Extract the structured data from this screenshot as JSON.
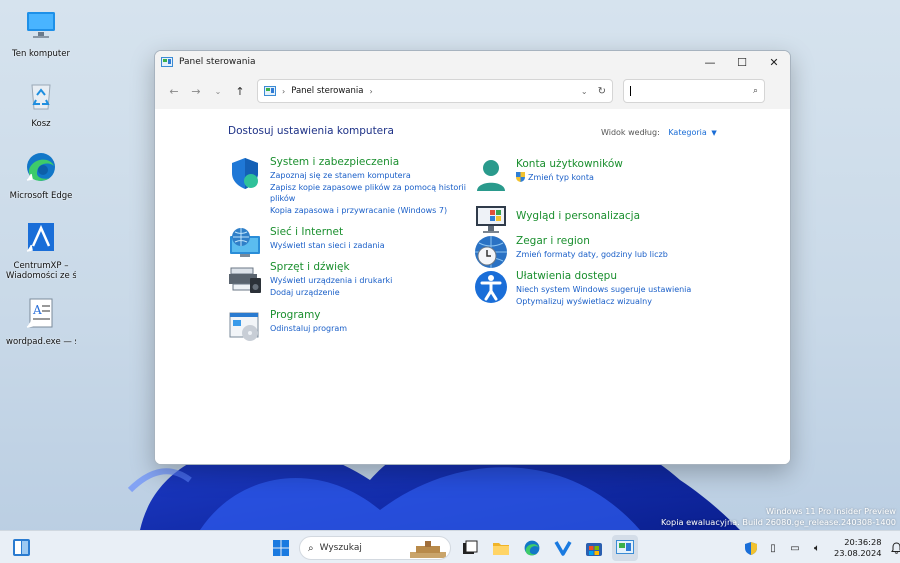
{
  "desktop": {
    "icons": [
      {
        "label": "Ten komputer",
        "icon": "monitor-icon"
      },
      {
        "label": "Kosz",
        "icon": "recycle-bin-icon"
      },
      {
        "label": "Microsoft Edge",
        "icon": "edge-icon"
      },
      {
        "label": "CentrumXP –",
        "label2": "Wiadomości ze ś...",
        "icon": "centrumxp-icon"
      },
      {
        "label": "wordpad.exe — skr...",
        "icon": "wordpad-icon"
      }
    ]
  },
  "window": {
    "title": "Panel sterowania",
    "controls": {
      "minimize": "—",
      "maximize": "☐",
      "close": "✕"
    },
    "breadcrumb": "Panel sterowania",
    "search_placeholder": "",
    "heading": "Dostosuj ustawienia komputera",
    "view_by_label": "Widok według:",
    "view_by_value": "Kategoria",
    "categories_left": [
      {
        "title": "System i zabezpieczenia",
        "icon": "system-security-shield-icon",
        "links": [
          "Zapoznaj się ze stanem komputera",
          "Zapisz kopie zapasowe plików za pomocą historii",
          "plików",
          "Kopia zapasowa i przywracanie (Windows 7)"
        ]
      },
      {
        "title": "Sieć i Internet",
        "icon": "network-globe-icon",
        "links": [
          "Wyświetl stan sieci i zadania"
        ]
      },
      {
        "title": "Sprzęt i dźwięk",
        "icon": "printer-speaker-icon",
        "links": [
          "Wyświetl urządzenia i drukarki",
          "Dodaj urządzenie"
        ]
      },
      {
        "title": "Programy",
        "icon": "programs-icon",
        "links": [
          "Odinstaluj program"
        ]
      }
    ],
    "categories_right": [
      {
        "title": "Konta użytkowników",
        "icon": "user-accounts-icon",
        "links": [
          "Zmień typ konta"
        ]
      },
      {
        "title": "Wygląd i personalizacja",
        "icon": "appearance-monitor-icon",
        "links": []
      },
      {
        "title": "Zegar i region",
        "icon": "clock-globe-icon",
        "links": [
          "Zmień formaty daty, godziny lub liczb"
        ]
      },
      {
        "title": "Ułatwienia dostępu",
        "icon": "accessibility-icon",
        "links": [
          "Niech system Windows sugeruje ustawienia",
          "Optymalizuj wyświetlacz wizualny"
        ]
      }
    ]
  },
  "watermark": {
    "line1": "Windows 11 Pro Insider Preview",
    "line2": "Kopia ewaluacyjna. Build 26080.ge_release.240308-1400"
  },
  "taskbar": {
    "search_label": "Wyszukaj",
    "time": "20:36:28",
    "date": "23.08.2024"
  },
  "colors": {
    "heading": "#1e3287",
    "category_title": "#1a8f2e",
    "link": "#1a5fc8",
    "accent": "#0078d4"
  }
}
